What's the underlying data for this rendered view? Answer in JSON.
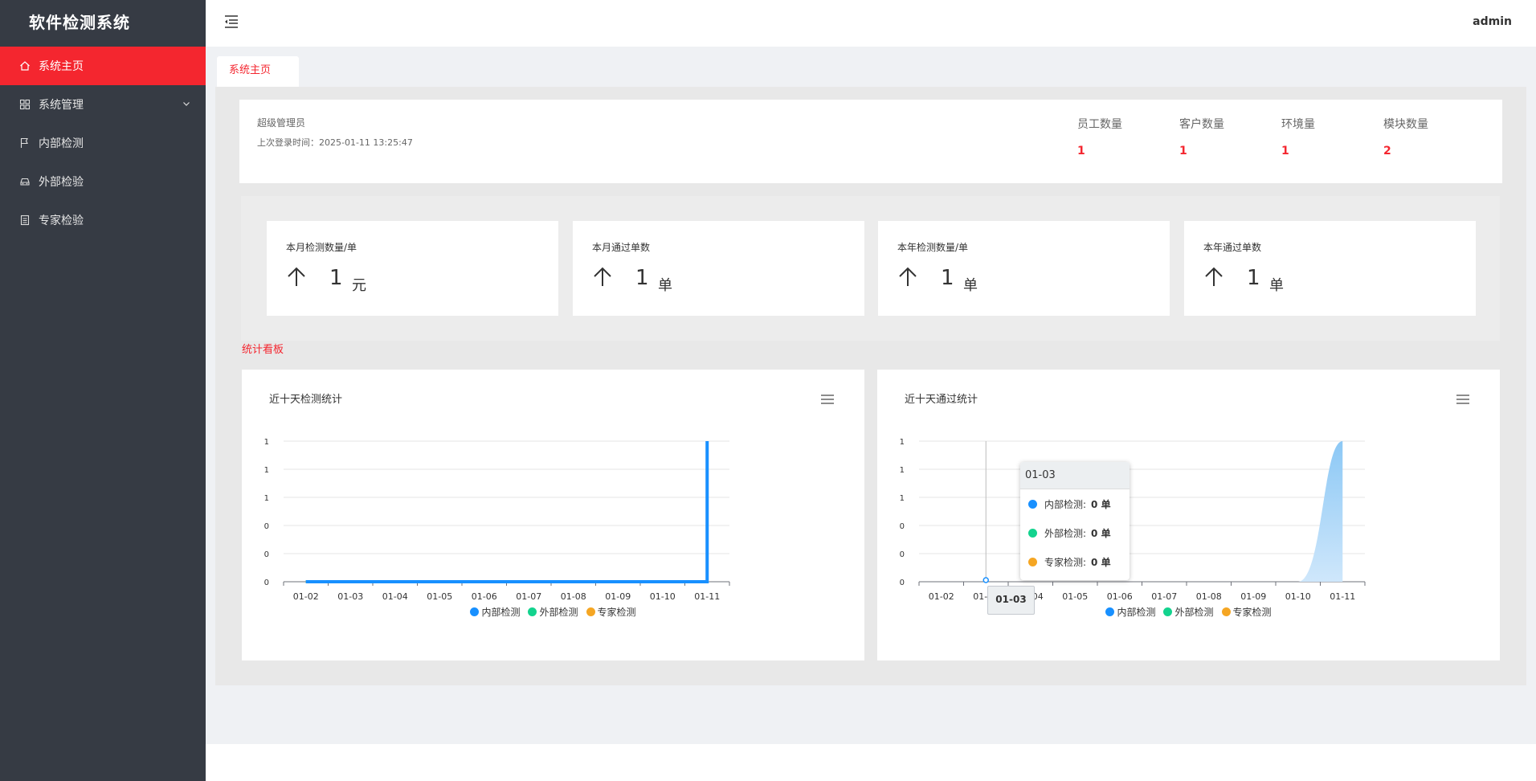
{
  "app": {
    "title": "软件检测系统"
  },
  "sidebar": {
    "items": [
      {
        "label": "系统主页",
        "icon": "home-icon",
        "active": true
      },
      {
        "label": "系统管理",
        "icon": "grid-icon",
        "has_submenu": true
      },
      {
        "label": "内部检测",
        "icon": "flag-icon"
      },
      {
        "label": "外部检验",
        "icon": "car-icon"
      },
      {
        "label": "专家检验",
        "icon": "document-icon"
      }
    ]
  },
  "header": {
    "user": "admin",
    "collapse_icon": "menu-collapse-icon"
  },
  "tabs": [
    {
      "label": "系统主页",
      "active": true
    }
  ],
  "info": {
    "role": "超级管理员",
    "last_login": "上次登录时间：2025-01-11 13:25:47",
    "stats": [
      {
        "label": "员工数量",
        "value": "1"
      },
      {
        "label": "客户数量",
        "value": "1"
      },
      {
        "label": "环境量",
        "value": "1"
      },
      {
        "label": "模块数量",
        "value": "2"
      }
    ]
  },
  "kpis": [
    {
      "label": "本月检测数量/单",
      "value": "1",
      "unit": "元"
    },
    {
      "label": "本月通过单数",
      "value": "1",
      "unit": "单"
    },
    {
      "label": "本年检测数量/单",
      "value": "1",
      "unit": "单"
    },
    {
      "label": "本年通过单数",
      "value": "1",
      "unit": "单"
    }
  ],
  "board_title": "统计看板",
  "colors": {
    "accent": "#f4262f",
    "sidebar": "#363b44",
    "series_blue": "#1890ff",
    "series_green": "#13d38e",
    "series_orange": "#f5a623"
  },
  "legend": [
    {
      "name": "内部检测",
      "color": "#1890ff"
    },
    {
      "name": "外部检测",
      "color": "#13d38e"
    },
    {
      "name": "专家检测",
      "color": "#f5a623"
    }
  ],
  "tooltip": {
    "date": "01-03",
    "rows": [
      {
        "label": "内部检测:",
        "value": "0 单",
        "color": "#1890ff"
      },
      {
        "label": "外部检测:",
        "value": "0 单",
        "color": "#13d38e"
      },
      {
        "label": "专家检测:",
        "value": "0 单",
        "color": "#f5a623"
      }
    ]
  },
  "chart_data": [
    {
      "type": "line",
      "title": "近十天检测统计",
      "categories": [
        "01-02",
        "01-03",
        "01-04",
        "01-05",
        "01-06",
        "01-07",
        "01-08",
        "01-09",
        "01-10",
        "01-11"
      ],
      "y_tick_labels": [
        "0",
        "0",
        "0",
        "1",
        "1",
        "1"
      ],
      "ylim": [
        0,
        1
      ],
      "grid": true,
      "legend_position": "bottom",
      "series": [
        {
          "name": "内部检测",
          "values": [
            0,
            0,
            0,
            0,
            0,
            0,
            0,
            0,
            0,
            1
          ]
        },
        {
          "name": "外部检测",
          "values": [
            0,
            0,
            0,
            0,
            0,
            0,
            0,
            0,
            0,
            0
          ]
        },
        {
          "name": "专家检测",
          "values": [
            0,
            0,
            0,
            0,
            0,
            0,
            0,
            0,
            0,
            0
          ]
        }
      ]
    },
    {
      "type": "area",
      "title": "近十天通过统计",
      "categories": [
        "01-02",
        "01-03",
        "01-04",
        "01-05",
        "01-06",
        "01-07",
        "01-08",
        "01-09",
        "01-10",
        "01-11"
      ],
      "y_tick_labels": [
        "0",
        "0",
        "0",
        "1",
        "1",
        "1"
      ],
      "ylim": [
        0,
        1
      ],
      "grid": true,
      "legend_position": "bottom",
      "series": [
        {
          "name": "内部检测",
          "values": [
            0,
            0,
            0,
            0,
            0,
            0,
            0,
            0,
            0,
            1
          ]
        },
        {
          "name": "外部检测",
          "values": [
            0,
            0,
            0,
            0,
            0,
            0,
            0,
            0,
            0,
            0
          ]
        },
        {
          "name": "专家检测",
          "values": [
            0,
            0,
            0,
            0,
            0,
            0,
            0,
            0,
            0,
            0
          ]
        }
      ]
    }
  ]
}
